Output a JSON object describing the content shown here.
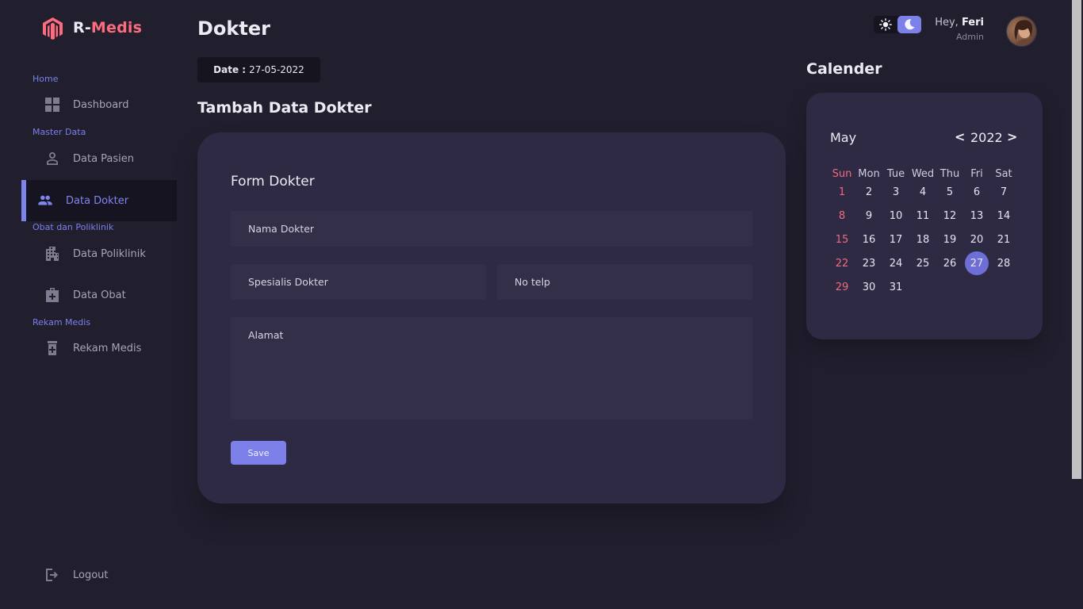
{
  "brand": {
    "prefix": "R-",
    "name": "Medis",
    "accent": "#fd6b7d"
  },
  "sidebar": {
    "sections": [
      {
        "label": "Home"
      },
      {
        "label": "Master Data"
      },
      {
        "label": "Obat dan Poliklinik"
      },
      {
        "label": "Rekam Medis"
      }
    ],
    "items": [
      {
        "label": "Dashboard",
        "icon": "dashboard-icon"
      },
      {
        "label": "Data Pasien",
        "icon": "person-icon"
      },
      {
        "label": "Data Dokter",
        "icon": "people-icon",
        "active": true
      },
      {
        "label": "Data Poliklinik",
        "icon": "building-icon"
      },
      {
        "label": "Data Obat",
        "icon": "medkit-icon"
      },
      {
        "label": "Rekam Medis",
        "icon": "medication-icon"
      }
    ],
    "logout": {
      "label": "Logout",
      "icon": "logout-icon"
    }
  },
  "header": {
    "title": "Dokter",
    "date_label": "Date :",
    "date_value": "27-05-2022",
    "greeting": "Hey,",
    "user_name": "Feri",
    "user_role": "Admin"
  },
  "form": {
    "section_title": "Tambah Data Dokter",
    "title": "Form Dokter",
    "fields": {
      "nama": "Nama Dokter",
      "spesialis": "Spesialis Dokter",
      "telp": "No telp",
      "alamat": "Alamat"
    },
    "save_label": "Save"
  },
  "calendar": {
    "heading": "Calender",
    "month": "May",
    "year": "2022",
    "prev": "<",
    "next": ">",
    "weekdays": [
      "Sun",
      "Mon",
      "Tue",
      "Wed",
      "Thu",
      "Fri",
      "Sat"
    ],
    "first_weekday_index": 0,
    "days_in_month": 31,
    "today": 27
  },
  "colors": {
    "accent": "#7c80e8",
    "danger": "#f16a80",
    "background": "#211f2e",
    "card": "#2e2a43"
  }
}
